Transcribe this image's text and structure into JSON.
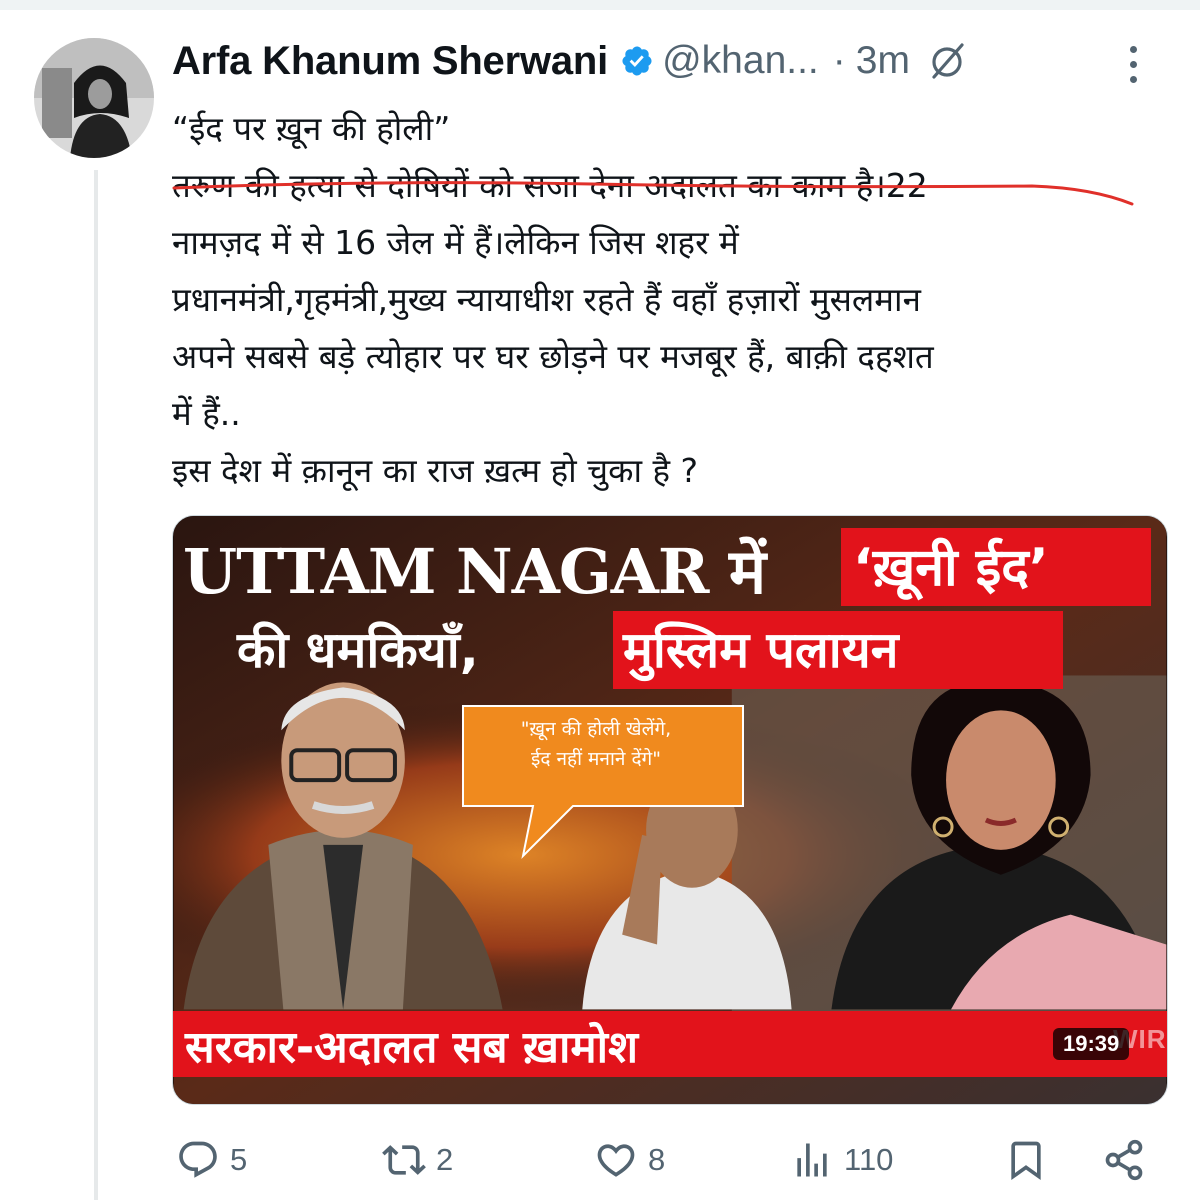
{
  "tweet": {
    "author_name": "Arfa Khanum Sherwani",
    "handle": "@khan...",
    "separator": "·",
    "time": "3m",
    "text_lines": [
      "“ईद पर ख़ून की होली”",
      "तरुण की हत्या से दोषियों को सजा देना अदालत का काम है।22",
      "नामज़द में से 16 जेल में हैं।लेकिन जिस शहर में",
      "प्रधानमंत्री,गृहमंत्री,मुख्य न्यायाधीश रहते हैं वहाँ हज़ारों मुसलमान",
      "अपने सबसे बड़े त्योहार पर घर छोड़ने पर मजबूर हैं, बाक़ी दहशत",
      "में हैं..",
      "इस देश में क़ानून का राज ख़त्म हो चुका है ?"
    ]
  },
  "media": {
    "headline_line1_white": "UTTAM NAGAR में",
    "headline_line1_red": "‘ख़ूनी ईद’",
    "headline_line2_white": "की धमकियाँ,",
    "headline_line2_red": "मुस्लिम पलायन",
    "speech_bubble": "\"ख़ून की होली खेलेंगे,\nईद नहीं मनाने देंगे\"",
    "bottom_banner": "सरकार-अदालत सब ख़ामोश",
    "duration": "19:39",
    "watermark": "WIRE"
  },
  "actions": {
    "replies": "5",
    "reposts": "2",
    "likes": "8",
    "views": "110"
  },
  "colors": {
    "text_primary": "#0f1419",
    "text_secondary": "#536471",
    "verified_blue": "#1d9bf0",
    "annotation_red": "#e0302a",
    "thumbnail_red": "#e2131b"
  },
  "icons": [
    "verified-badge-icon",
    "grok-icon",
    "more-icon",
    "reply-icon",
    "repost-icon",
    "like-icon",
    "views-icon",
    "bookmark-icon",
    "share-icon"
  ]
}
